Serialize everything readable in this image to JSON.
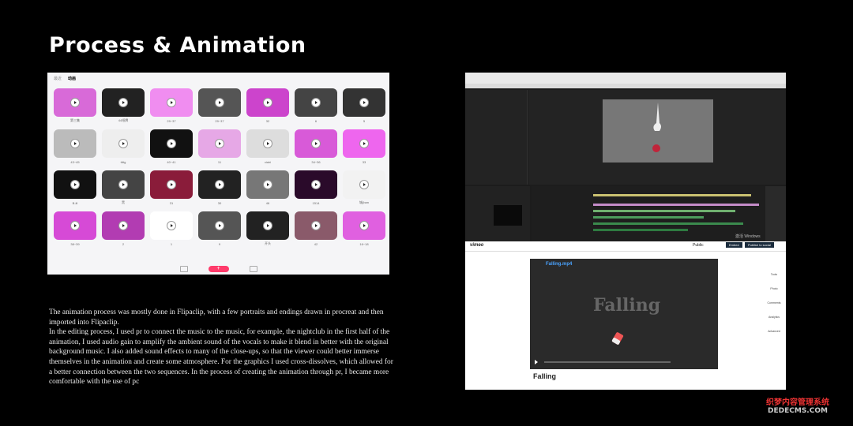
{
  "title": "Process & Animation",
  "flipaclip": {
    "tabs": [
      "最近",
      "动画"
    ],
    "tiles": [
      {
        "label": "第三集",
        "bg": "#d86ad8"
      },
      {
        "label": "44纸牌",
        "bg": "#222"
      },
      {
        "label": "29~37",
        "bg": "#f08df0"
      },
      {
        "label": "29~37",
        "bg": "#555"
      },
      {
        "label": "32",
        "bg": "#cc44cc"
      },
      {
        "label": "6",
        "bg": "#444"
      },
      {
        "label": "5",
        "bg": "#333"
      },
      {
        "label": "43~45",
        "bg": "#bbb"
      },
      {
        "label": "ttttg",
        "bg": "#eee"
      },
      {
        "label": "40~41",
        "bg": "#111"
      },
      {
        "label": "11",
        "bg": "#e6a8e6"
      },
      {
        "label": "xiahi",
        "bg": "#ddd"
      },
      {
        "label": "34~36",
        "bg": "#d85ad8"
      },
      {
        "label": "33",
        "bg": "#ee66ee"
      },
      {
        "label": "B-ill",
        "bg": "#111"
      },
      {
        "label": "黑",
        "bg": "#444"
      },
      {
        "label": "31",
        "bg": "#8a1c3a"
      },
      {
        "label": "30",
        "bg": "#222"
      },
      {
        "label": "46",
        "bg": "#777"
      },
      {
        "label": "1514",
        "bg": "#2a0a2a"
      },
      {
        "label": "城(ban",
        "bg": "#f2f2f2"
      },
      {
        "label": "38~39",
        "bg": "#d64ad6"
      },
      {
        "label": "2",
        "bg": "#b23cb2"
      },
      {
        "label": "1",
        "bg": "#fff"
      },
      {
        "label": "9",
        "bg": "#555"
      },
      {
        "label": "开头",
        "bg": "#222"
      },
      {
        "label": "42",
        "bg": "#8a5a6a"
      },
      {
        "label": "16~18",
        "bg": "#e060e0"
      }
    ],
    "add_label": "+"
  },
  "paragraphs": [
    "The animation process was mostly done in Flipaclip, with a few portraits and endings drawn in procreat and then imported into Flipaclip.",
    "In the editing process, I used pr to connect the music to the music, for example, the nightclub in the first half of the animation, I used audio gain to amplify the ambient sound of the vocals to make it blend in better with the original background music. I also added sound effects to many of the close-ups, so that the viewer could better immerse themselves in the animation and create some atmosphere. For the graphics I used cross-dissolves, which allowed for a better connection between the two sequences. In the process of creating the animation through pr, I became more comfortable with the use of pc"
  ],
  "premiere": {
    "windows_watermark": "激活 Windows"
  },
  "vimeo": {
    "logo": "vimeo",
    "visibility": "Public",
    "embed_label": "Embed",
    "share_label": "Publish to social",
    "video_filename": "Falling.mp4",
    "video_title_overlay": "Falling",
    "footer_title": "Falling",
    "side_items": [
      "Tools",
      "Photo",
      "Comments",
      "Analytics",
      "Advanced"
    ]
  },
  "credit": {
    "line1": "织梦内容管理系统",
    "line2": "DEDECMS.COM"
  }
}
